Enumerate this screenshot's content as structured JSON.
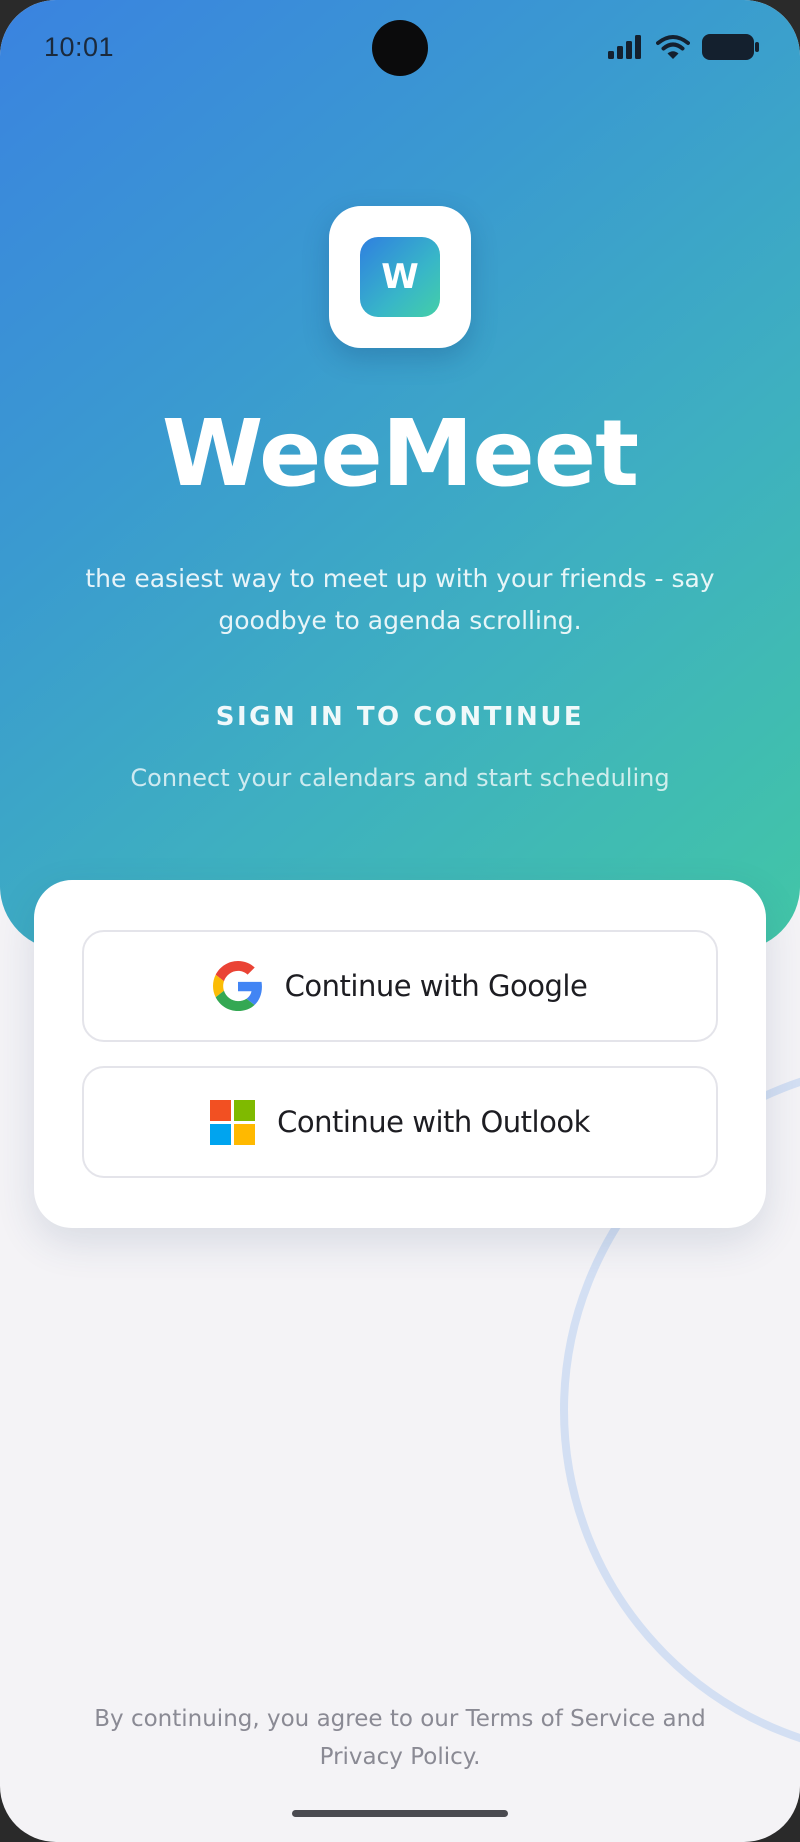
{
  "status_bar": {
    "time": "10:01"
  },
  "app": {
    "logo_letter": "W",
    "title": "WeeMeet",
    "tagline": "the easiest way to meet up with your friends - say goodbye to agenda scrolling."
  },
  "signin": {
    "heading": "SIGN IN TO CONTINUE",
    "subheading": "Connect your calendars and start scheduling"
  },
  "auth": {
    "google_label": "Continue with Google",
    "outlook_label": "Continue with Outlook"
  },
  "legal": {
    "text": "By continuing, you agree to our Terms of Service and Privacy Policy."
  },
  "icons": {
    "status": [
      "signal-icon",
      "wifi-icon",
      "battery-icon"
    ],
    "auth": [
      "google-icon",
      "microsoft-icon"
    ]
  },
  "colors": {
    "hero_gradient_start": "#3a83e0",
    "hero_gradient_end": "#42c6a6",
    "background": "#f4f3f6",
    "microsoft_red": "#f25022",
    "microsoft_green": "#7fba00",
    "microsoft_blue": "#00a4ef",
    "microsoft_yellow": "#ffb900"
  }
}
